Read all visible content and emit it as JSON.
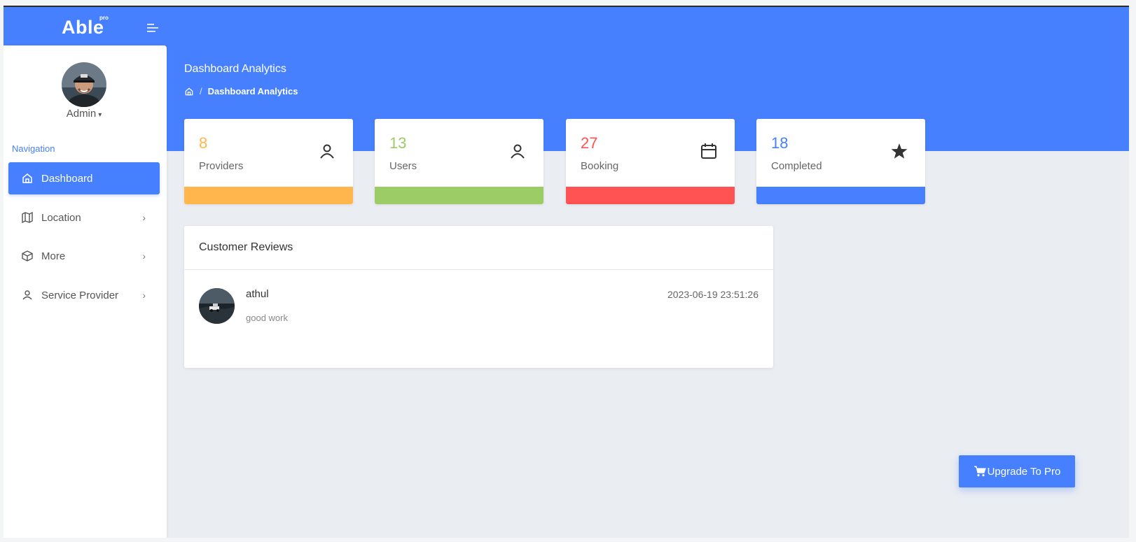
{
  "brand": {
    "name": "Able",
    "sup": "pro"
  },
  "sidebar": {
    "user": "Admin",
    "caret": "▾",
    "nav_heading": "Navigation",
    "items": [
      {
        "label": "Dashboard",
        "icon": "home-icon",
        "active": true
      },
      {
        "label": "Location",
        "icon": "map-icon",
        "chevron": "›"
      },
      {
        "label": "More",
        "icon": "box-icon",
        "chevron": "›"
      },
      {
        "label": "Service Provider",
        "icon": "user-icon",
        "chevron": "›"
      }
    ]
  },
  "header": {
    "title": "Dashboard Analytics",
    "breadcrumb": {
      "separator": "/",
      "current": "Dashboard Analytics"
    }
  },
  "stats": [
    {
      "value": "8",
      "label": "Providers",
      "icon": "user-icon",
      "color": "#ffb64d"
    },
    {
      "value": "13",
      "label": "Users",
      "icon": "user-icon",
      "color": "#9ccc65"
    },
    {
      "value": "27",
      "label": "Booking",
      "icon": "calendar-icon",
      "color": "#ff5252"
    },
    {
      "value": "18",
      "label": "Completed",
      "icon": "star-icon",
      "color": "#4680ff"
    }
  ],
  "reviews": {
    "title": "Customer Reviews",
    "items": [
      {
        "name": "athul",
        "text": "good work",
        "time": "2023-06-19 23:51:26"
      }
    ]
  },
  "upgrade": {
    "label": "Upgrade To Pro",
    "icon": "cart-icon"
  },
  "colors": {
    "primary": "#4680ff",
    "background": "#eaedf2"
  }
}
